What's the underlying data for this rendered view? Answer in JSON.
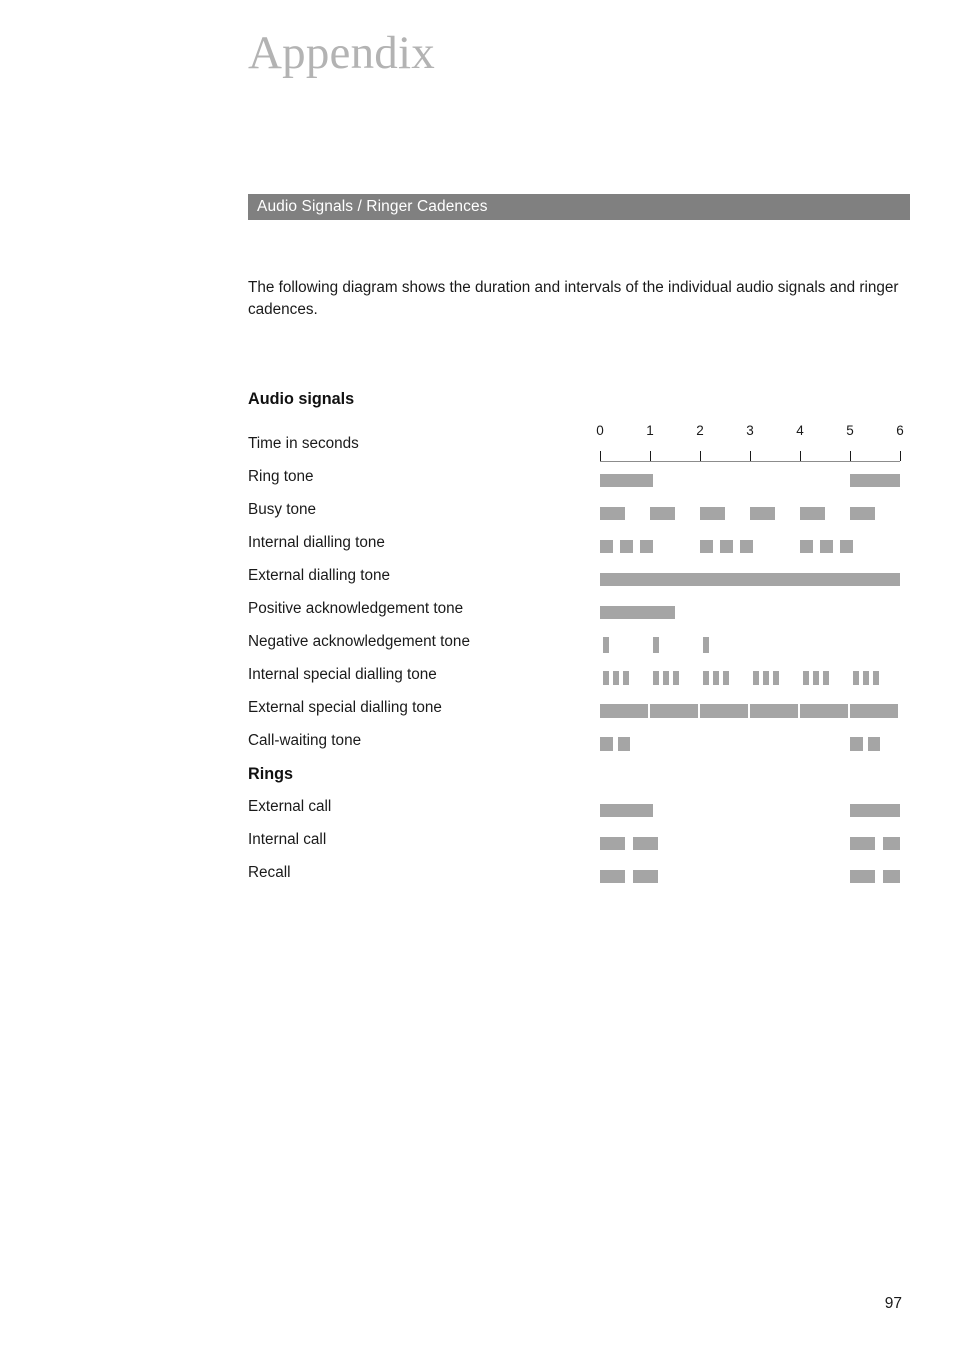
{
  "page": {
    "title": "Appendix",
    "number": "97"
  },
  "section": {
    "title": "Audio Signals / Ringer Cadences"
  },
  "intro": {
    "text": "The following diagram shows the duration and intervals of the individual audio signals and ringer cadences."
  },
  "chart_data": {
    "type": "timeline",
    "title": "Audio Signals / Ringer Cadences",
    "xlabel": "Time in seconds",
    "xlim": [
      0,
      6
    ],
    "x_ticks": [
      "0",
      "1",
      "2",
      "3",
      "4",
      "5",
      "6"
    ],
    "grid": false,
    "legend": "none",
    "units": "seconds",
    "groups": [
      {
        "heading": "Audio signals",
        "axis_label": "Time in seconds",
        "rows": [
          {
            "label": "Ring tone",
            "height": 13,
            "intervals": [
              [
                0.0,
                1.05
              ],
              [
                5.0,
                6.0
              ]
            ]
          },
          {
            "label": "Busy tone",
            "height": 13,
            "intervals": [
              [
                0.0,
                0.5
              ],
              [
                1.0,
                1.5
              ],
              [
                2.0,
                2.5
              ],
              [
                3.0,
                3.5
              ],
              [
                4.0,
                4.5
              ],
              [
                5.0,
                5.5
              ]
            ]
          },
          {
            "label": "Internal dialling tone",
            "height": 13,
            "intervals": [
              [
                0.0,
                0.25
              ],
              [
                0.4,
                0.65
              ],
              [
                0.8,
                1.05
              ],
              [
                2.0,
                2.25
              ],
              [
                2.4,
                2.65
              ],
              [
                2.8,
                3.05
              ],
              [
                4.0,
                4.25
              ],
              [
                4.4,
                4.65
              ],
              [
                4.8,
                5.05
              ]
            ]
          },
          {
            "label": "External dialling tone",
            "height": 13,
            "intervals": [
              [
                0.0,
                6.0
              ]
            ]
          },
          {
            "label": "Positive acknowledgement tone",
            "height": 13,
            "intervals": [
              [
                0.0,
                1.5
              ]
            ]
          },
          {
            "label": "Negative acknowledgement tone",
            "height": 16,
            "intervals": [
              [
                0.05,
                0.17
              ],
              [
                1.05,
                1.17
              ],
              [
                2.05,
                2.17
              ]
            ]
          },
          {
            "label": "Internal special dialling tone",
            "height": 14,
            "intervals": [
              [
                0.05,
                0.18
              ],
              [
                0.25,
                0.38
              ],
              [
                0.45,
                0.58
              ],
              [
                1.05,
                1.18
              ],
              [
                1.25,
                1.38
              ],
              [
                1.45,
                1.58
              ],
              [
                2.05,
                2.18
              ],
              [
                2.25,
                2.38
              ],
              [
                2.45,
                2.58
              ],
              [
                3.05,
                3.18
              ],
              [
                3.25,
                3.38
              ],
              [
                3.45,
                3.58
              ],
              [
                4.05,
                4.18
              ],
              [
                4.25,
                4.38
              ],
              [
                4.45,
                4.58
              ],
              [
                5.05,
                5.18
              ],
              [
                5.25,
                5.38
              ],
              [
                5.45,
                5.58
              ]
            ]
          },
          {
            "label": "External special dialling tone",
            "height": 14,
            "intervals": [
              [
                0.0,
                0.95
              ],
              [
                1.0,
                1.95
              ],
              [
                2.0,
                2.95
              ],
              [
                3.0,
                3.95
              ],
              [
                4.0,
                4.95
              ],
              [
                5.0,
                5.95
              ]
            ]
          },
          {
            "label": "Call-waiting tone",
            "height": 14,
            "intervals": [
              [
                0.0,
                0.25
              ],
              [
                0.35,
                0.6
              ],
              [
                5.0,
                5.25
              ],
              [
                5.35,
                5.6
              ]
            ]
          }
        ]
      },
      {
        "heading": "Rings",
        "rows": [
          {
            "label": "External call",
            "height": 13,
            "intervals": [
              [
                0.0,
                1.05
              ],
              [
                5.0,
                6.0
              ]
            ]
          },
          {
            "label": "Internal call",
            "height": 13,
            "intervals": [
              [
                0.0,
                0.5
              ],
              [
                0.65,
                1.15
              ],
              [
                5.0,
                5.5
              ],
              [
                5.65,
                6.0
              ]
            ]
          },
          {
            "label": "Recall",
            "height": 13,
            "intervals": [
              [
                0.0,
                0.5
              ],
              [
                0.65,
                1.15
              ],
              [
                5.0,
                5.5
              ],
              [
                5.65,
                6.0
              ]
            ]
          }
        ]
      }
    ],
    "colors": {
      "pulse": "#a5a5a5",
      "axis": "#8c8c8c",
      "header_bar": "#808080",
      "title": "#b3b3b3"
    }
  }
}
